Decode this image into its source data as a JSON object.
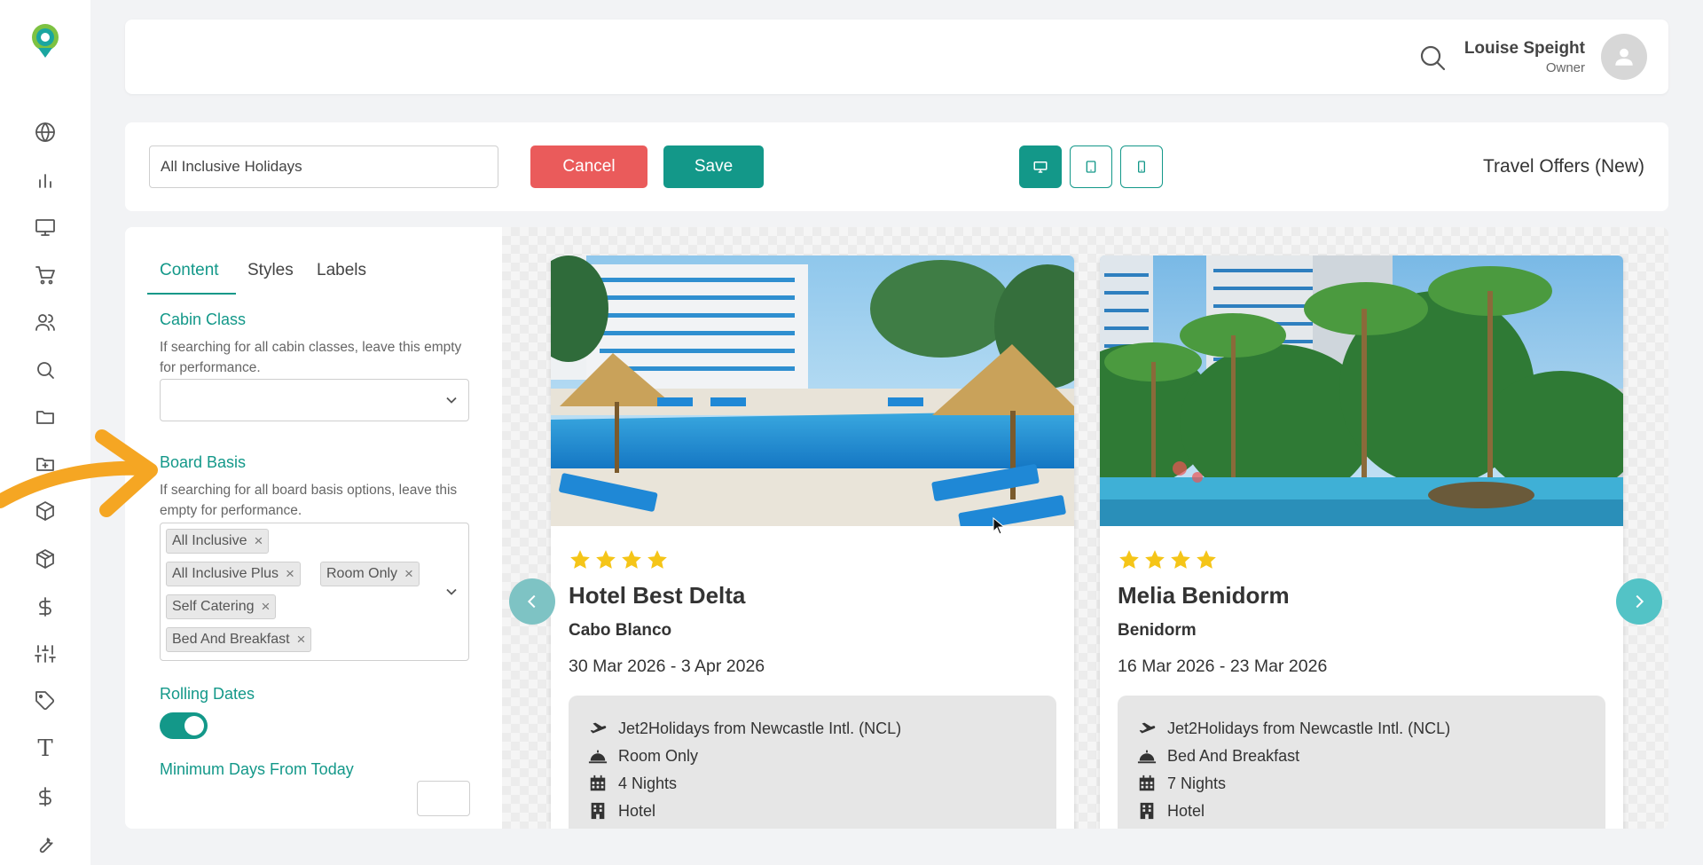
{
  "sidebar": {
    "items": [
      {
        "icon": "globe-icon"
      },
      {
        "icon": "bar-chart-icon"
      },
      {
        "icon": "monitor-icon"
      },
      {
        "icon": "cart-icon"
      },
      {
        "icon": "users-icon"
      },
      {
        "icon": "search-icon"
      },
      {
        "icon": "folder-icon"
      },
      {
        "icon": "folder-plus-icon"
      },
      {
        "icon": "cube-icon"
      },
      {
        "icon": "package-icon"
      },
      {
        "icon": "dollar-icon"
      },
      {
        "icon": "sliders-icon"
      },
      {
        "icon": "tag-icon"
      },
      {
        "icon": "text-icon"
      },
      {
        "icon": "dollar-alt-icon"
      },
      {
        "icon": "wrench-icon"
      }
    ]
  },
  "header": {
    "user_name": "Louise Speight",
    "user_role": "Owner"
  },
  "toolbar": {
    "name_value": "All Inclusive Holidays",
    "cancel_label": "Cancel",
    "save_label": "Save",
    "title": "Travel Offers (New)"
  },
  "panel": {
    "tabs": [
      {
        "label": "Content"
      },
      {
        "label": "Styles"
      },
      {
        "label": "Labels"
      }
    ],
    "cabin_class": {
      "title": "Cabin Class",
      "help": "If searching for all cabin classes, leave this empty for performance."
    },
    "board_basis": {
      "title": "Board Basis",
      "help": "If searching for all board basis options, leave this empty for performance.",
      "chips": [
        "All Inclusive",
        "All Inclusive Plus",
        "Room Only",
        "Self Catering",
        "Bed And Breakfast"
      ]
    },
    "rolling_dates": {
      "title": "Rolling Dates",
      "enabled": true
    },
    "min_days": {
      "title": "Minimum Days From Today"
    }
  },
  "cards": [
    {
      "stars": 4,
      "name": "Hotel Best Delta",
      "location": "Cabo Blanco",
      "dates": "30 Mar 2026 - 3 Apr 2026",
      "flight": "Jet2Holidays from Newcastle Intl. (NCL)",
      "board": "Room Only",
      "nights": "4 Nights",
      "type": "Hotel"
    },
    {
      "stars": 4,
      "name": "Melia Benidorm",
      "location": "Benidorm",
      "dates": "16 Mar 2026 - 23 Mar 2026",
      "flight": "Jet2Holidays from Newcastle Intl. (NCL)",
      "board": "Bed And Breakfast",
      "nights": "7 Nights",
      "type": "Hotel"
    }
  ],
  "colors": {
    "accent": "#139889",
    "cancel": "#ea5b5b",
    "star": "#f5c518",
    "annotation_arrow": "#f5a623"
  }
}
